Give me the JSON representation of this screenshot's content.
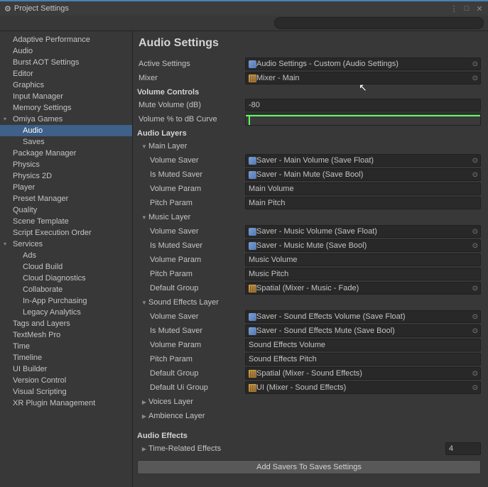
{
  "window": {
    "title": "Project Settings"
  },
  "sidebar": {
    "items": [
      {
        "label": "Adaptive Performance",
        "level": 1
      },
      {
        "label": "Audio",
        "level": 1
      },
      {
        "label": "Burst AOT Settings",
        "level": 1
      },
      {
        "label": "Editor",
        "level": 1
      },
      {
        "label": "Graphics",
        "level": 1
      },
      {
        "label": "Input Manager",
        "level": 1
      },
      {
        "label": "Memory Settings",
        "level": 1
      },
      {
        "label": "Omiya Games",
        "level": 1,
        "expandable": true
      },
      {
        "label": "Audio",
        "level": 2,
        "selected": true
      },
      {
        "label": "Saves",
        "level": 2
      },
      {
        "label": "Package Manager",
        "level": 1
      },
      {
        "label": "Physics",
        "level": 1
      },
      {
        "label": "Physics 2D",
        "level": 1
      },
      {
        "label": "Player",
        "level": 1
      },
      {
        "label": "Preset Manager",
        "level": 1
      },
      {
        "label": "Quality",
        "level": 1
      },
      {
        "label": "Scene Template",
        "level": 1
      },
      {
        "label": "Script Execution Order",
        "level": 1
      },
      {
        "label": "Services",
        "level": 1,
        "expandable": true
      },
      {
        "label": "Ads",
        "level": 2
      },
      {
        "label": "Cloud Build",
        "level": 2
      },
      {
        "label": "Cloud Diagnostics",
        "level": 2
      },
      {
        "label": "Collaborate",
        "level": 2
      },
      {
        "label": "In-App Purchasing",
        "level": 2
      },
      {
        "label": "Legacy Analytics",
        "level": 2
      },
      {
        "label": "Tags and Layers",
        "level": 1
      },
      {
        "label": "TextMesh Pro",
        "level": 1
      },
      {
        "label": "Time",
        "level": 1
      },
      {
        "label": "Timeline",
        "level": 1
      },
      {
        "label": "UI Builder",
        "level": 1
      },
      {
        "label": "Version Control",
        "level": 1
      },
      {
        "label": "Visual Scripting",
        "level": 1
      },
      {
        "label": "XR Plugin Management",
        "level": 1
      }
    ]
  },
  "content": {
    "title": "Audio Settings",
    "activeSettings": {
      "label": "Active Settings",
      "value": "Audio Settings - Custom (Audio Settings)"
    },
    "mixer": {
      "label": "Mixer",
      "value": "Mixer - Main"
    },
    "volumeControlsHeader": "Volume Controls",
    "muteVolume": {
      "label": "Mute Volume (dB)",
      "value": "-80"
    },
    "volumeCurve": {
      "label": "Volume % to dB Curve"
    },
    "audioLayersHeader": "Audio Layers",
    "mainLayer": {
      "label": "Main Layer",
      "volumeSaver": {
        "label": "Volume Saver",
        "value": "Saver - Main Volume (Save Float)"
      },
      "isMutedSaver": {
        "label": "Is Muted Saver",
        "value": "Saver - Main Mute (Save Bool)"
      },
      "volumeParam": {
        "label": "Volume Param",
        "value": "Main Volume"
      },
      "pitchParam": {
        "label": "Pitch Param",
        "value": "Main Pitch"
      }
    },
    "musicLayer": {
      "label": "Music Layer",
      "volumeSaver": {
        "label": "Volume Saver",
        "value": "Saver - Music Volume (Save Float)"
      },
      "isMutedSaver": {
        "label": "Is Muted Saver",
        "value": "Saver - Music Mute (Save Bool)"
      },
      "volumeParam": {
        "label": "Volume Param",
        "value": "Music Volume"
      },
      "pitchParam": {
        "label": "Pitch Param",
        "value": "Music Pitch"
      },
      "defaultGroup": {
        "label": "Default Group",
        "value": "Spatial (Mixer - Music - Fade)"
      }
    },
    "sfxLayer": {
      "label": "Sound Effects Layer",
      "volumeSaver": {
        "label": "Volume Saver",
        "value": "Saver - Sound Effects Volume (Save Float)"
      },
      "isMutedSaver": {
        "label": "Is Muted Saver",
        "value": "Saver - Sound Effects Mute (Save Bool)"
      },
      "volumeParam": {
        "label": "Volume Param",
        "value": "Sound Effects Volume"
      },
      "pitchParam": {
        "label": "Pitch Param",
        "value": "Sound Effects Pitch"
      },
      "defaultGroup": {
        "label": "Default Group",
        "value": "Spatial (Mixer - Sound Effects)"
      },
      "defaultUiGroup": {
        "label": "Default Ui Group",
        "value": "UI (Mixer - Sound Effects)"
      }
    },
    "voicesLayer": {
      "label": "Voices Layer"
    },
    "ambienceLayer": {
      "label": "Ambience Layer"
    },
    "audioEffectsHeader": "Audio Effects",
    "timeEffects": {
      "label": "Time-Related Effects",
      "value": "4"
    },
    "addSaversButton": "Add Savers To Saves Settings"
  }
}
